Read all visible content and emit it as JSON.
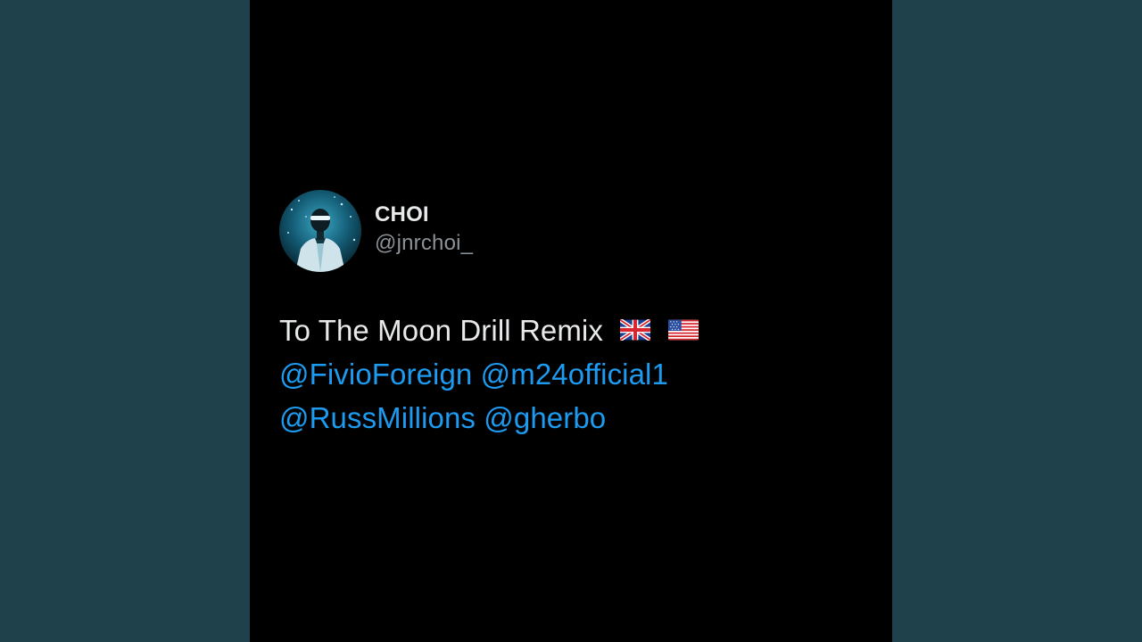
{
  "colors": {
    "page_background": "#1f414b",
    "card_background": "#000000",
    "text_primary": "#e7e9ea",
    "text_secondary": "#8b9298",
    "mention": "#1d9bf0"
  },
  "author": {
    "display_name": "CHOI",
    "handle": "@jnrchoi_",
    "avatar_icon": "profile-photo"
  },
  "tweet": {
    "text": "To The Moon Drill Remix",
    "flags": [
      "uk-flag-icon",
      "us-flag-icon"
    ],
    "mentions": [
      "@FivioForeign",
      "@m24official1",
      "@RussMillions",
      "@gherbo"
    ]
  }
}
